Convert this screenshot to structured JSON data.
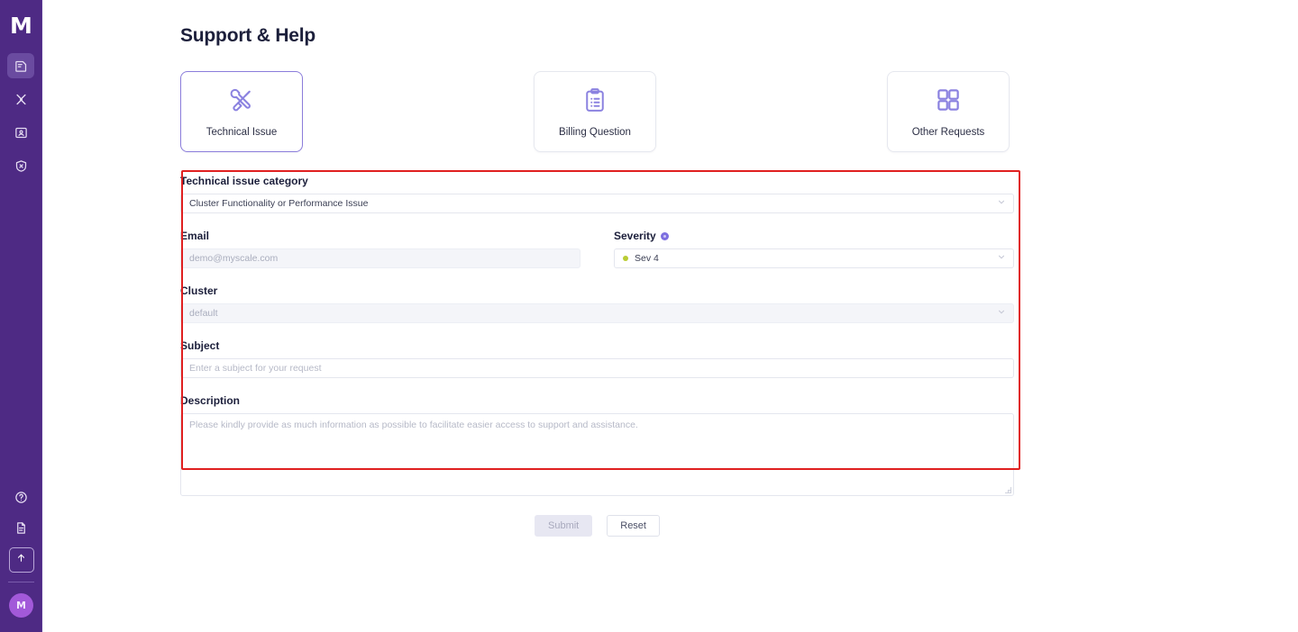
{
  "sidebar": {
    "logo": "M",
    "top_items": [
      {
        "name": "clusters",
        "icon": "database-icon",
        "active": true
      },
      {
        "name": "tools",
        "icon": "wrench-icon",
        "active": false
      },
      {
        "name": "account",
        "icon": "id-card-icon",
        "active": false
      },
      {
        "name": "security",
        "icon": "shield-icon",
        "active": false
      }
    ],
    "bottom_items": [
      {
        "name": "help",
        "icon": "help-circle-icon"
      },
      {
        "name": "docs",
        "icon": "document-icon"
      }
    ],
    "upgrade": {
      "icon": "arrow-up-icon",
      "label": ""
    },
    "avatar_initial": "M",
    "bg_color": "#4e2a84",
    "active_bg_color": "#6a4ba0",
    "avatar_color": "#a259d9"
  },
  "page": {
    "title": "Support & Help"
  },
  "categories": [
    {
      "label": "Technical Issue",
      "icon": "wrench-screwdriver-icon",
      "selected": true
    },
    {
      "label": "Billing Question",
      "icon": "clipboard-list-icon",
      "selected": false
    },
    {
      "label": "Other Requests",
      "icon": "grid-squares-icon",
      "selected": false
    }
  ],
  "form": {
    "category": {
      "label": "Technical issue category",
      "value": "Cluster Functionality or Performance Issue"
    },
    "email": {
      "label": "Email",
      "value": "demo@myscale.com",
      "disabled": true
    },
    "severity": {
      "label": "Severity",
      "value": "Sev 4",
      "dot_color": "#b9cc33",
      "has_info_icon": true
    },
    "cluster": {
      "label": "Cluster",
      "value": "default",
      "disabled": true
    },
    "subject": {
      "label": "Subject",
      "placeholder": "Enter a subject for your request",
      "value": ""
    },
    "description": {
      "label": "Description",
      "placeholder": "Please kindly provide as much information as possible to facilitate easier access to support and assistance.",
      "value": ""
    }
  },
  "actions": {
    "submit_label": "Submit",
    "submit_disabled": true,
    "reset_label": "Reset"
  },
  "annotation": {
    "highlight_color": "#e02020"
  }
}
